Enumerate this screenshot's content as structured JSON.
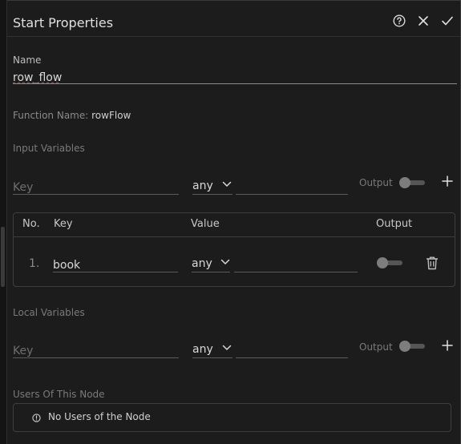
{
  "header": {
    "title": "Start Properties",
    "help_icon": "help-circle-icon",
    "close_icon": "close-icon",
    "confirm_icon": "check-icon"
  },
  "name_field": {
    "label": "Name",
    "value": "row_flow"
  },
  "function_name": {
    "label": "Function Name:",
    "value": "rowFlow"
  },
  "input_variables": {
    "section_label": "Input Variables",
    "key_placeholder": "Key",
    "type_value": "any",
    "output_label": "Output",
    "table": {
      "headers": {
        "no": "No.",
        "key": "Key",
        "value": "Value",
        "output": "Output"
      },
      "rows": [
        {
          "no": "1.",
          "key": "book",
          "type": "any",
          "value": "",
          "output": false
        }
      ]
    }
  },
  "local_variables": {
    "section_label": "Local Variables",
    "key_placeholder": "Key",
    "type_value": "any",
    "output_label": "Output"
  },
  "users": {
    "section_label": "Users Of This Node",
    "empty_text": "No Users of the Node"
  }
}
